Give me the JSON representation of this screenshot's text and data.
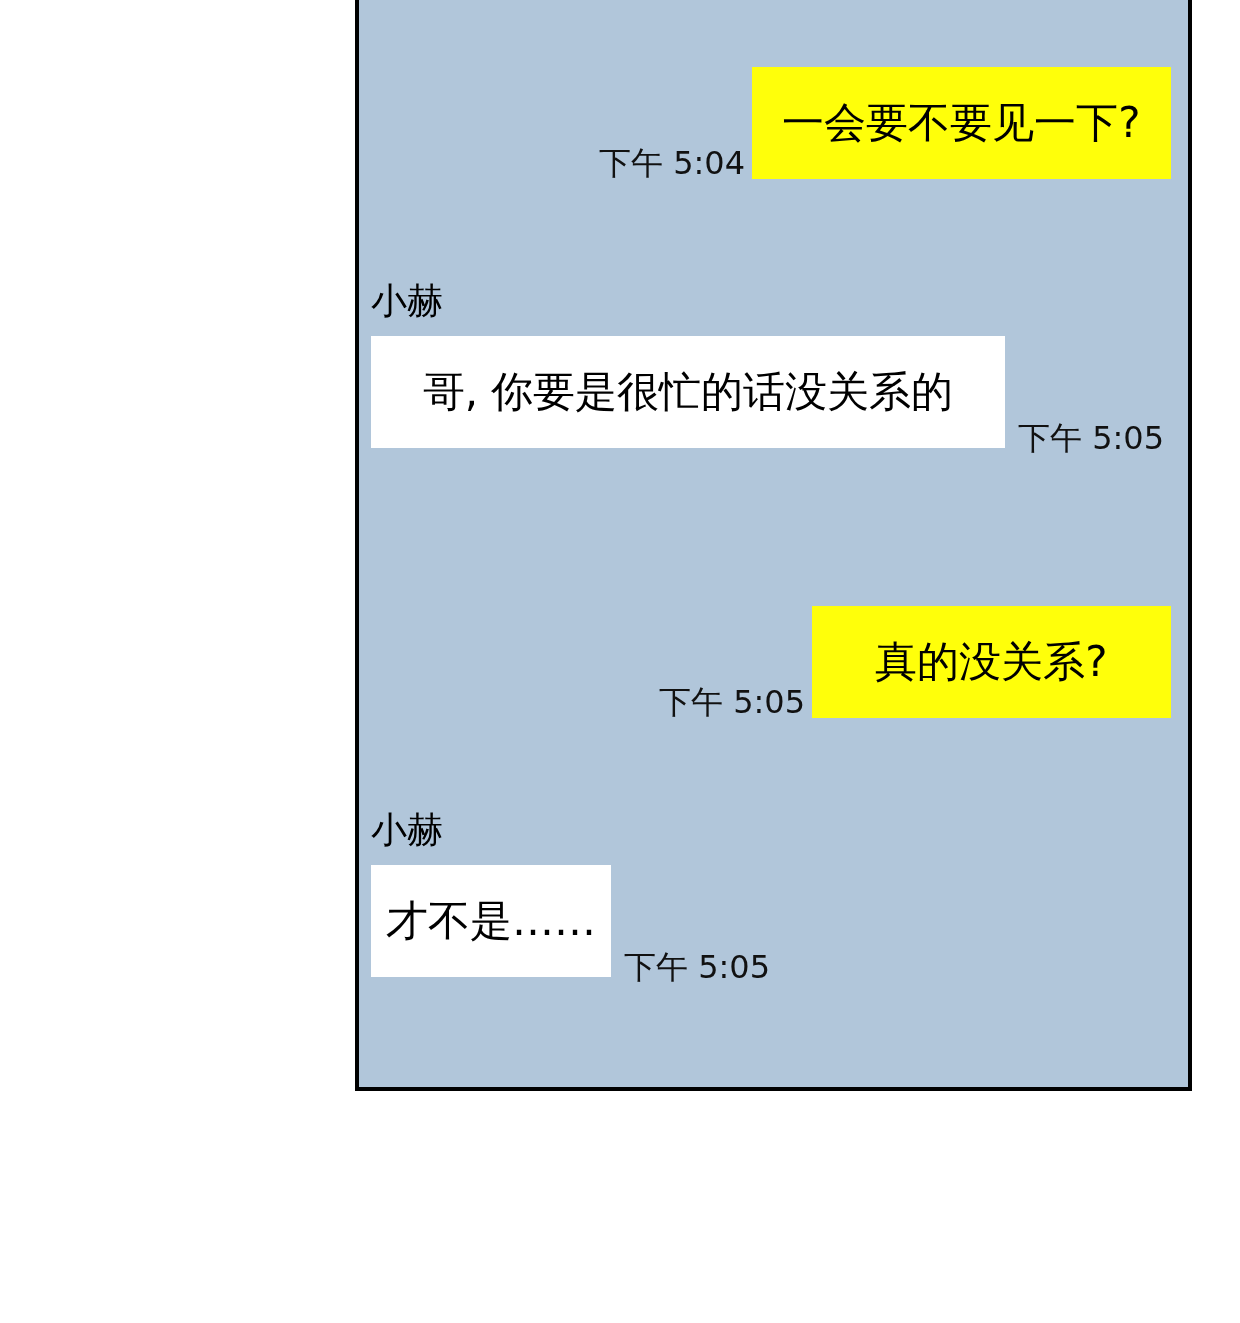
{
  "messages": [
    {
      "kind": "sent",
      "text": "一会要不要见一下?",
      "time": "下午 5:04"
    },
    {
      "kind": "received",
      "sender": "小赫",
      "text": "哥, 你要是很忙的话没关系的",
      "time": "下午 5:05"
    },
    {
      "kind": "sent",
      "text": "真的没关系?",
      "time": "下午 5:05"
    },
    {
      "kind": "received",
      "sender": "小赫",
      "text": "才不是……",
      "time": "下午 5:05"
    }
  ]
}
